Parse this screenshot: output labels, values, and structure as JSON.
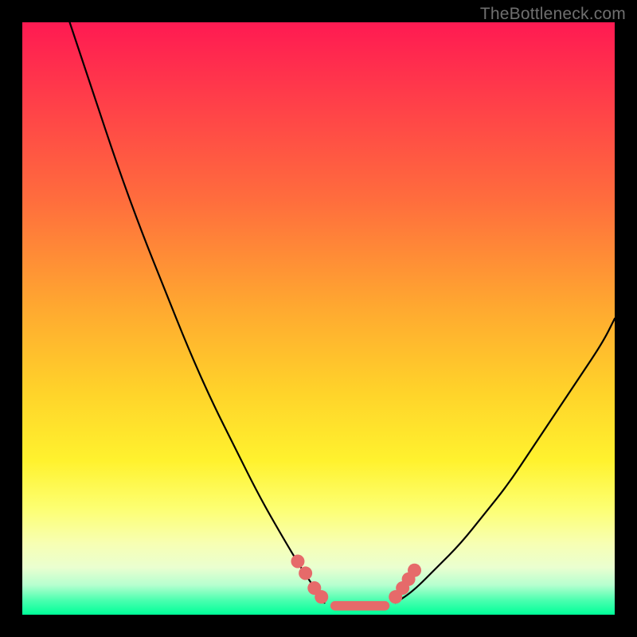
{
  "watermark": "TheBottleneck.com",
  "colors": {
    "bead": "#e66a6a",
    "curve": "#000000",
    "frame": "#000000"
  },
  "chart_data": {
    "type": "line",
    "title": "",
    "xlabel": "",
    "ylabel": "",
    "xlim": [
      0,
      100
    ],
    "ylim": [
      0,
      100
    ],
    "note": "Bottleneck-style V-curve. y≈0 (green) means optimal; higher y (toward red) means worse. Minimum plateau roughly x≈52–62; curve rises steeply to the left reaching ~100 at x≈8, and rises to the right reaching ~50 at x≈100.",
    "left_curve": {
      "x": [
        8,
        12,
        16,
        20,
        24,
        28,
        32,
        36,
        40,
        44,
        47,
        49,
        51
      ],
      "y": [
        100,
        88,
        76,
        65,
        55,
        45,
        36,
        28,
        20,
        13,
        8,
        5,
        2
      ]
    },
    "right_curve": {
      "x": [
        63,
        66,
        70,
        74,
        78,
        82,
        86,
        90,
        94,
        98,
        100
      ],
      "y": [
        2,
        4,
        8,
        12,
        17,
        22,
        28,
        34,
        40,
        46,
        50
      ]
    },
    "plateau": {
      "x_start": 51,
      "x_end": 63,
      "y": 1.5
    },
    "beads_left": [
      {
        "x": 46.5,
        "y": 9
      },
      {
        "x": 47.8,
        "y": 7
      },
      {
        "x": 49.3,
        "y": 4.5
      },
      {
        "x": 50.5,
        "y": 3
      }
    ],
    "beads_right": [
      {
        "x": 63.0,
        "y": 3
      },
      {
        "x": 64.2,
        "y": 4.5
      },
      {
        "x": 65.2,
        "y": 6
      },
      {
        "x": 66.2,
        "y": 7.5
      }
    ],
    "bottom_bar": {
      "x_start": 52,
      "x_end": 62,
      "y": 1.5,
      "thickness_pct": 1.6
    }
  }
}
